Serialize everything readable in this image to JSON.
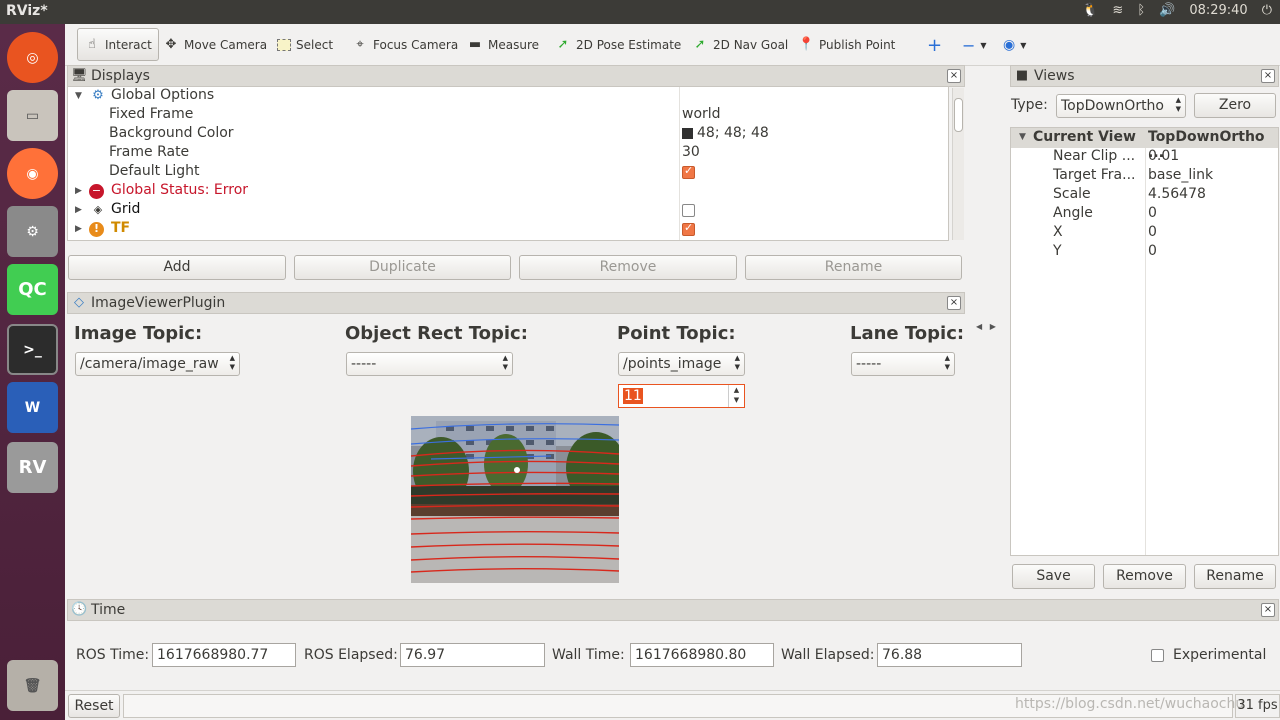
{
  "window": {
    "title": "RViz*",
    "clock": "08:29:40"
  },
  "toolbar": {
    "tools": [
      {
        "label": "Interact",
        "icon": "hand-icon"
      },
      {
        "label": "Move Camera",
        "icon": "move-icon"
      },
      {
        "label": "Select",
        "icon": "select-icon"
      },
      {
        "label": "Focus Camera",
        "icon": "focus-icon"
      },
      {
        "label": "Measure",
        "icon": "ruler-icon"
      },
      {
        "label": "2D Pose Estimate",
        "icon": "pose-arrow-icon"
      },
      {
        "label": "2D Nav Goal",
        "icon": "nav-arrow-icon"
      },
      {
        "label": "Publish Point",
        "icon": "pin-icon"
      }
    ]
  },
  "displays": {
    "title": "Displays",
    "rows": [
      {
        "name": "Global Options",
        "value": ""
      },
      {
        "name": "Fixed Frame",
        "value": "world"
      },
      {
        "name": "Background Color",
        "value": "48; 48; 48"
      },
      {
        "name": "Frame Rate",
        "value": "30"
      },
      {
        "name": "Default Light",
        "value": ""
      },
      {
        "name": "Global Status: Error",
        "value": ""
      },
      {
        "name": "Grid",
        "value": ""
      },
      {
        "name": "TF",
        "value": ""
      }
    ],
    "buttons": {
      "add": "Add",
      "duplicate": "Duplicate",
      "remove": "Remove",
      "rename": "Rename"
    }
  },
  "plugin": {
    "title": "ImageViewerPlugin",
    "image_topic_label": "Image Topic:",
    "image_topic_value": "/camera/image_raw",
    "object_rect_label": "Object Rect Topic:",
    "object_rect_value": "-----",
    "point_topic_label": "Point Topic:",
    "point_topic_value": "/points_image",
    "point_size_value": "11",
    "lane_topic_label": "Lane Topic:",
    "lane_topic_value": "-----"
  },
  "views": {
    "title": "Views",
    "type_label": "Type:",
    "type_value": "TopDownOrtho",
    "zero_label": "Zero",
    "header": {
      "name": "Current View",
      "value": "TopDownOrtho ..."
    },
    "rows": [
      {
        "name": "Near Clip ...",
        "value": "0.01"
      },
      {
        "name": "Target Fra...",
        "value": "base_link"
      },
      {
        "name": "Scale",
        "value": "4.56478"
      },
      {
        "name": "Angle",
        "value": "0"
      },
      {
        "name": "X",
        "value": "0"
      },
      {
        "name": "Y",
        "value": "0"
      }
    ],
    "buttons": {
      "save": "Save",
      "remove": "Remove",
      "rename": "Rename"
    }
  },
  "time": {
    "title": "Time",
    "ros_time_label": "ROS Time:",
    "ros_time": "1617668980.77",
    "ros_elapsed_label": "ROS Elapsed:",
    "ros_elapsed": "76.97",
    "wall_time_label": "Wall Time:",
    "wall_time": "1617668980.80",
    "wall_elapsed_label": "Wall Elapsed:",
    "wall_elapsed": "76.88",
    "experimental_label": "Experimental"
  },
  "status": {
    "reset_label": "Reset",
    "watermark": "https://blog.csdn.net/wuchaochu",
    "fps": "31 fps"
  },
  "colors": {
    "error": "#c7162b",
    "warn": "#e88b1a",
    "accent": "#f07746",
    "background_swatch": "#303030"
  }
}
